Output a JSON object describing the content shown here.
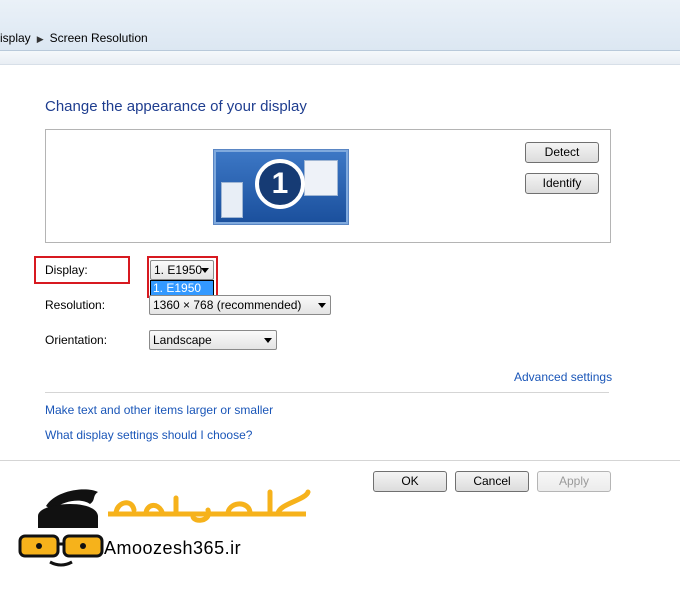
{
  "breadcrumb": {
    "items": [
      "isplay",
      "Screen Resolution"
    ]
  },
  "page": {
    "title": "Change the appearance of your display"
  },
  "preview": {
    "monitor_number": "1",
    "detect_label": "Detect",
    "identify_label": "Identify"
  },
  "fields": {
    "display": {
      "label": "Display:",
      "value": "1. E1950",
      "options": [
        "1. E1950"
      ]
    },
    "resolution": {
      "label": "Resolution:",
      "value": "1360 × 768 (recommended)"
    },
    "orientation": {
      "label": "Orientation:",
      "value": "Landscape"
    }
  },
  "links": {
    "advanced": "Advanced settings",
    "text_size": "Make text and other items larger or smaller",
    "help": "What display settings should I choose?"
  },
  "footer": {
    "ok_label": "OK",
    "cancel_label": "Cancel",
    "apply_label": "Apply"
  },
  "watermark": {
    "persian_text": "آمـــوزش ۳۶۵",
    "latin_text": "Amoozesh365.ir"
  },
  "colors": {
    "accent_red": "#d71920",
    "link_blue": "#1a56b8",
    "title_blue": "#1e3d8f",
    "logo_yellow": "#f6b21b"
  }
}
